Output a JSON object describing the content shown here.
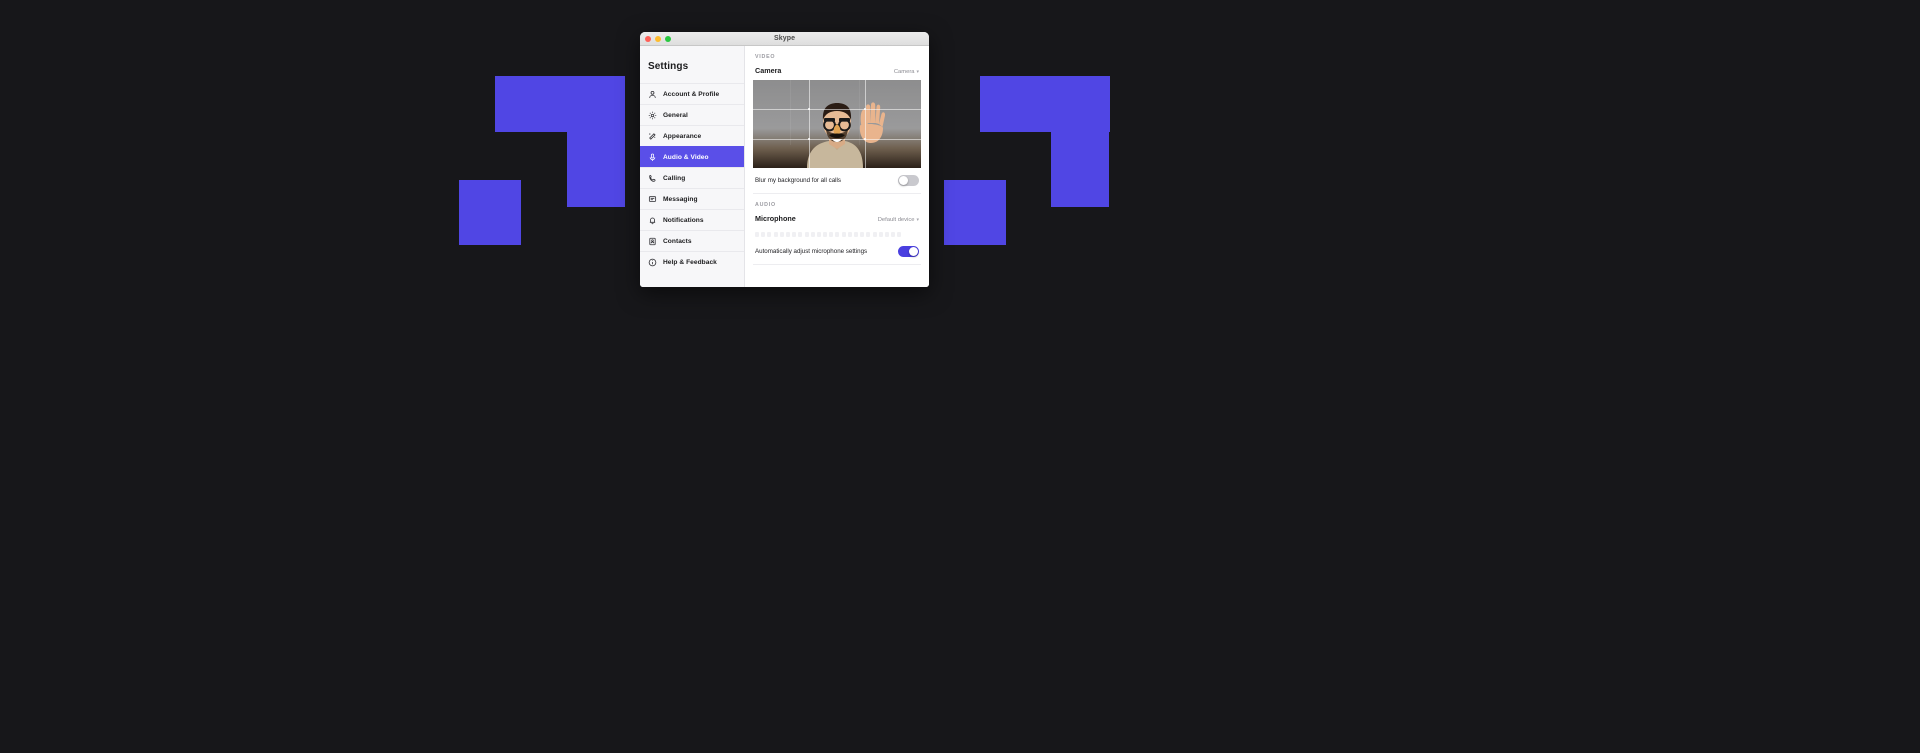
{
  "window": {
    "title": "Skype",
    "traffic_lights": [
      "close",
      "minimize",
      "zoom"
    ]
  },
  "sidebar": {
    "heading": "Settings",
    "items": [
      {
        "label": "Account & Profile",
        "icon": "person-icon",
        "active": false
      },
      {
        "label": "General",
        "icon": "gear-icon",
        "active": false
      },
      {
        "label": "Appearance",
        "icon": "magic-wand-icon",
        "active": false
      },
      {
        "label": "Audio & Video",
        "icon": "microphone-icon",
        "active": true
      },
      {
        "label": "Calling",
        "icon": "phone-icon",
        "active": false
      },
      {
        "label": "Messaging",
        "icon": "chat-bubble-icon",
        "active": false
      },
      {
        "label": "Notifications",
        "icon": "bell-icon",
        "active": false
      },
      {
        "label": "Contacts",
        "icon": "contact-card-icon",
        "active": false
      },
      {
        "label": "Help & Feedback",
        "icon": "info-circle-icon",
        "active": false
      }
    ]
  },
  "main": {
    "video_section": {
      "header": "VIDEO",
      "camera_label": "Camera",
      "camera_device": "Camera",
      "blur_label": "Blur my background for all calls",
      "blur_enabled": false
    },
    "audio_section": {
      "header": "AUDIO",
      "microphone_label": "Microphone",
      "microphone_device": "Default device",
      "mic_level_segments": 24,
      "auto_adjust_label": "Automatically adjust microphone settings",
      "auto_adjust_enabled": true
    }
  },
  "colors": {
    "accent": "#5046e4",
    "sidebar_active": "#5a4fe8",
    "toggle_on": "#4a3fe0",
    "toggle_off": "#c9c9ce",
    "desktop_background": "#17171a"
  }
}
